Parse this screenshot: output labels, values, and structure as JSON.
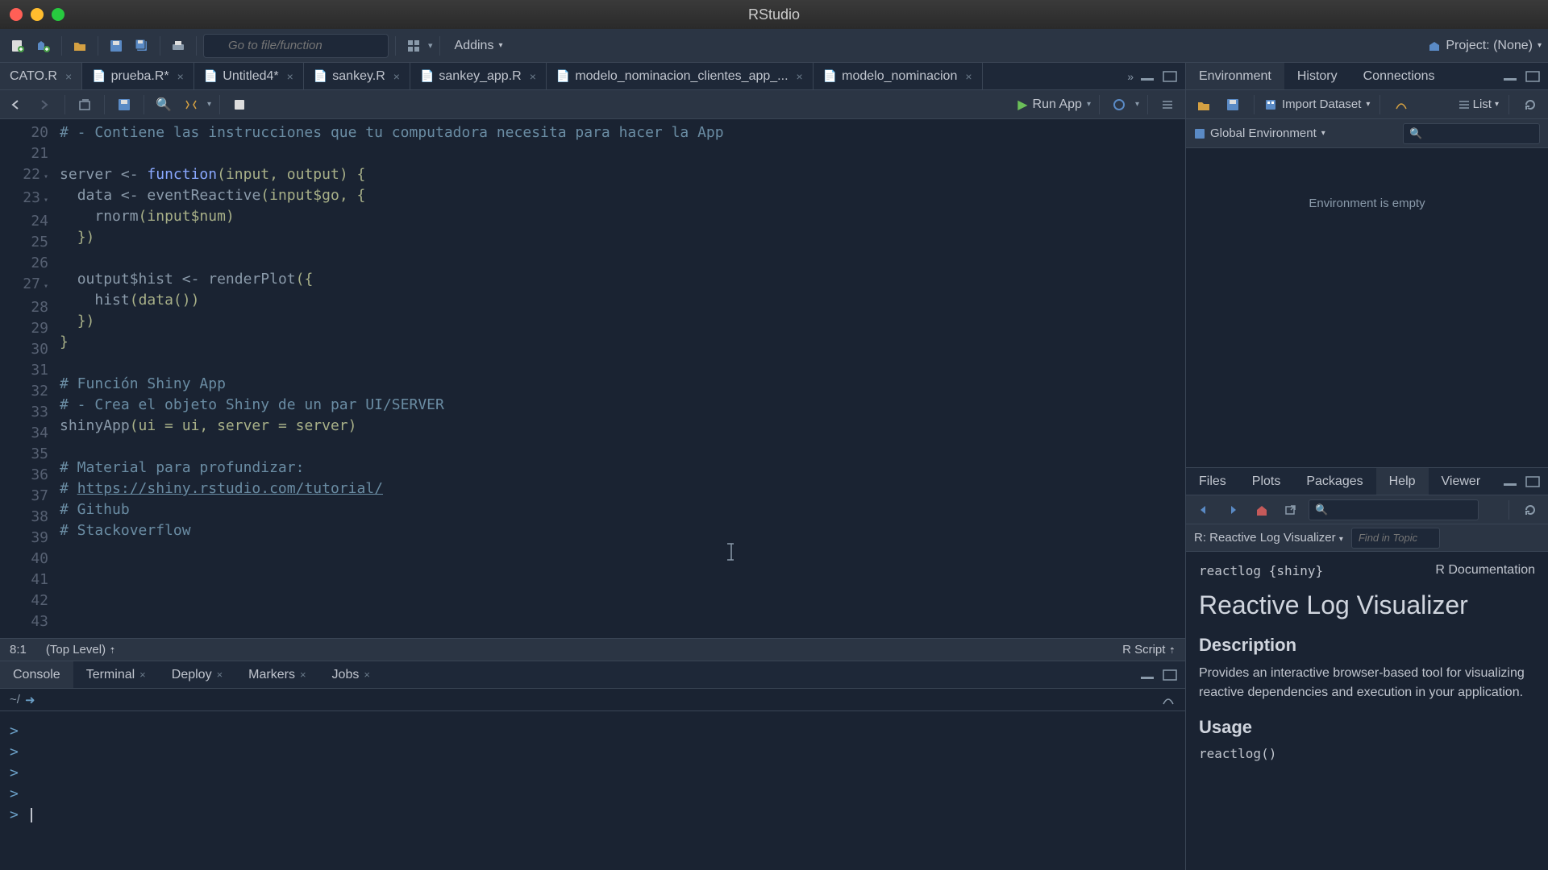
{
  "window": {
    "title": "RStudio"
  },
  "toolbar": {
    "goto_placeholder": "Go to file/function",
    "addins": "Addins",
    "project": "Project: (None)"
  },
  "editor_tabs": [
    {
      "label": "CATO.R",
      "active": true,
      "modified": false
    },
    {
      "label": "prueba.R*",
      "active": false,
      "modified": true
    },
    {
      "label": "Untitled4*",
      "active": false,
      "modified": true
    },
    {
      "label": "sankey.R",
      "active": false,
      "modified": false
    },
    {
      "label": "sankey_app.R",
      "active": false,
      "modified": false
    },
    {
      "label": "modelo_nominacion_clientes_app_...",
      "active": false,
      "modified": false
    },
    {
      "label": "modelo_nominacion",
      "active": false,
      "modified": false
    }
  ],
  "run_button": "Run App",
  "code_lines": [
    {
      "n": 20,
      "comment": "# - Contiene las instrucciones que tu computadora necesita para hacer la App"
    },
    {
      "n": 21,
      "plain": ""
    },
    {
      "n": 22,
      "code": {
        "pre": "server ",
        "op": "<-",
        "post": " ",
        "kw": "function",
        "args": "(input, output) {"
      },
      "fold": true
    },
    {
      "n": 23,
      "code": {
        "indent": "  ",
        "pre": "data ",
        "op": "<-",
        "post": " eventReactive",
        "args": "(input$go, {"
      },
      "fold": true
    },
    {
      "n": 24,
      "code": {
        "indent": "    ",
        "pre": "rnorm",
        "args": "(input$num)"
      }
    },
    {
      "n": 25,
      "code": {
        "indent": "  ",
        "args": "})"
      }
    },
    {
      "n": 26,
      "plain": ""
    },
    {
      "n": 27,
      "code": {
        "indent": "  ",
        "pre": "output$hist ",
        "op": "<-",
        "post": " renderPlot",
        "args": "({"
      },
      "fold": true
    },
    {
      "n": 28,
      "code": {
        "indent": "    ",
        "pre": "hist",
        "args": "(data())"
      }
    },
    {
      "n": 29,
      "code": {
        "indent": "  ",
        "args": "})"
      }
    },
    {
      "n": 30,
      "code": {
        "args": "}"
      }
    },
    {
      "n": 31,
      "plain": ""
    },
    {
      "n": 32,
      "comment": "# Función Shiny App"
    },
    {
      "n": 33,
      "comment": "# - Crea el objeto Shiny de un par UI/SERVER"
    },
    {
      "n": 34,
      "code": {
        "pre": "shinyApp",
        "args": "(ui = ui, server = server)"
      }
    },
    {
      "n": 35,
      "plain": ""
    },
    {
      "n": 36,
      "comment": "# Material para profundizar:"
    },
    {
      "n": 37,
      "comment_prefix": "# ",
      "url": "https://shiny.rstudio.com/tutorial/"
    },
    {
      "n": 38,
      "comment": "# Github"
    },
    {
      "n": 39,
      "comment": "# Stackoverflow"
    },
    {
      "n": 40,
      "plain": ""
    },
    {
      "n": 41,
      "plain": ""
    },
    {
      "n": 42,
      "plain": ""
    },
    {
      "n": 43,
      "plain": ""
    }
  ],
  "statusbar": {
    "pos": "8:1",
    "scope": "(Top Level)",
    "lang": "R Script"
  },
  "lower_tabs": [
    {
      "label": "Console",
      "active": true,
      "closable": false
    },
    {
      "label": "Terminal",
      "active": false,
      "closable": true
    },
    {
      "label": "Deploy",
      "active": false,
      "closable": true
    },
    {
      "label": "Markers",
      "active": false,
      "closable": true
    },
    {
      "label": "Jobs",
      "active": false,
      "closable": true
    }
  ],
  "console_path": "~/",
  "console_prompts": [
    ">",
    ">",
    ">",
    ">",
    ">"
  ],
  "env_tabs": [
    {
      "label": "Environment",
      "active": true
    },
    {
      "label": "History",
      "active": false
    },
    {
      "label": "Connections",
      "active": false
    }
  ],
  "env": {
    "import": "Import Dataset",
    "list": "List",
    "scope": "Global Environment",
    "empty": "Environment is empty"
  },
  "help_tabs": [
    {
      "label": "Files",
      "active": false
    },
    {
      "label": "Plots",
      "active": false
    },
    {
      "label": "Packages",
      "active": false
    },
    {
      "label": "Help",
      "active": true
    },
    {
      "label": "Viewer",
      "active": false
    }
  ],
  "help": {
    "topic_dropdown": "R: Reactive Log Visualizer",
    "find_placeholder": "Find in Topic",
    "pkg": "reactlog {shiny}",
    "rdoc": "R Documentation",
    "title": "Reactive Log Visualizer",
    "h_desc": "Description",
    "desc": "Provides an interactive browser-based tool for visualizing reactive dependencies and execution in your application.",
    "h_usage": "Usage",
    "usage": "reactlog()"
  }
}
